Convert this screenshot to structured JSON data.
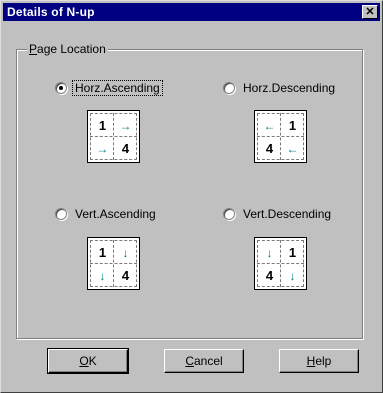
{
  "window": {
    "title": "Details of N-up",
    "close_glyph": "✕"
  },
  "group": {
    "label_prefix": "",
    "label_underlined": "P",
    "label_rest": "age Location"
  },
  "options": [
    {
      "label": "Horz.Ascending",
      "checked": true,
      "cells": [
        "1",
        "→",
        "→",
        "4"
      ]
    },
    {
      "label": "Horz.Descending",
      "checked": false,
      "cells": [
        "←",
        "1",
        "4",
        "←"
      ]
    },
    {
      "label": "Vert.Ascending",
      "checked": false,
      "cells": [
        "1",
        "↓",
        "↓",
        "4"
      ]
    },
    {
      "label": "Vert.Descending",
      "checked": false,
      "cells": [
        "↓",
        "1",
        "4",
        "↓"
      ]
    }
  ],
  "buttons": {
    "ok": {
      "underlined": "O",
      "rest": "K"
    },
    "cancel": {
      "underlined": "C",
      "rest": "ancel"
    },
    "help": {
      "underlined": "H",
      "rest": "elp"
    }
  },
  "colors": {
    "title_bar": "#000080",
    "face": "#c0c0c0",
    "arrow": "#008080"
  }
}
